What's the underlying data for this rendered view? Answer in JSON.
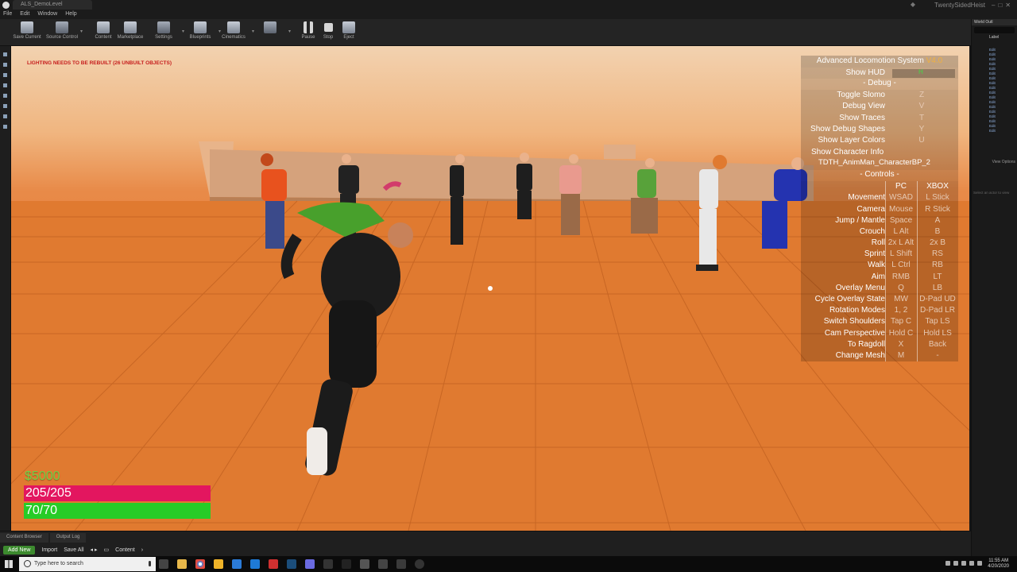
{
  "window": {
    "tab_title": "ALS_DemoLevel",
    "project": "TwentySidedHeist",
    "menu": [
      "File",
      "Edit",
      "Window",
      "Help"
    ]
  },
  "toolbar": [
    {
      "label": "Save Current",
      "icon": "save-icon"
    },
    {
      "label": "Source Control",
      "icon": "source-control-icon"
    },
    {
      "label": "Content",
      "icon": "content-icon"
    },
    {
      "label": "Marketplace",
      "icon": "marketplace-icon"
    },
    {
      "label": "Settings",
      "icon": "settings-icon"
    },
    {
      "label": "Blueprints",
      "icon": "blueprints-icon"
    },
    {
      "label": "Cinematics",
      "icon": "cinematics-icon"
    },
    {
      "label": "",
      "icon": "build-icon"
    },
    {
      "label": "Pause",
      "icon": "pause-icon"
    },
    {
      "label": "Stop",
      "icon": "stop-icon"
    },
    {
      "label": "Eject",
      "icon": "eject-icon"
    }
  ],
  "viewport": {
    "warning": "LIGHTING NEEDS TO BE REBUILT (26 unbuilt objects)"
  },
  "als": {
    "title": "Advanced Locomotion System",
    "version": "V4.0",
    "show_hud": {
      "label": "Show HUD",
      "value": "H"
    },
    "debug_header": "- Debug -",
    "debug_items": [
      {
        "label": "Toggle Slomo",
        "key": "Z"
      },
      {
        "label": "Debug View",
        "key": "V"
      },
      {
        "label": "Show Traces",
        "key": "T"
      },
      {
        "label": "Show Debug Shapes",
        "key": "Y"
      },
      {
        "label": "Show Layer Colors",
        "key": "U"
      }
    ],
    "char_info_label": "Show Character Info",
    "char_info_value": "TDTH_AnimMan_CharacterBP_2",
    "controls_header": "- Controls -",
    "col_pc": "PC",
    "col_xbox": "XBOX",
    "controls": [
      {
        "label": "Movement",
        "pc": "WSAD",
        "xbox": "L Stick"
      },
      {
        "label": "Camera",
        "pc": "Mouse",
        "xbox": "R Stick"
      },
      {
        "label": "Jump / Mantle",
        "pc": "Space",
        "xbox": "A"
      },
      {
        "label": "Crouch",
        "pc": "L Alt",
        "xbox": "B"
      },
      {
        "label": "Roll",
        "pc": "2x L Alt",
        "xbox": "2x B"
      },
      {
        "label": "Sprint",
        "pc": "L Shift",
        "xbox": "RS"
      },
      {
        "label": "Walk",
        "pc": "L Ctrl",
        "xbox": "RB"
      },
      {
        "label": "Aim",
        "pc": "RMB",
        "xbox": "LT"
      },
      {
        "label": "Overlay Menu",
        "pc": "Q",
        "xbox": "LB"
      },
      {
        "label": "Cycle Overlay State",
        "pc": "MW",
        "xbox": "D-Pad UD"
      },
      {
        "label": "Rotation Modes",
        "pc": "1, 2",
        "xbox": "D-Pad LR"
      },
      {
        "label": "Switch Shoulders",
        "pc": "Tap C",
        "xbox": "Tap LS"
      },
      {
        "label": "Cam Perspective",
        "pc": "Hold C",
        "xbox": "Hold LS"
      },
      {
        "label": "To Ragdoll",
        "pc": "X",
        "xbox": "Back"
      },
      {
        "label": "Change Mesh",
        "pc": "M",
        "xbox": "-"
      }
    ]
  },
  "hud": {
    "money": "$5000",
    "health": {
      "text": "205/205",
      "fraction": 1.0,
      "color": "#e3165f"
    },
    "stamina": {
      "text": "70/70",
      "fraction": 1.0,
      "color": "#27cc27"
    }
  },
  "bottom": {
    "tabs": [
      "Content Browser",
      "Output Log"
    ],
    "add_new": "Add New",
    "import": "Import",
    "save_all": "Save All",
    "path": "Content"
  },
  "outliner": {
    "title": "World Outl",
    "column": "Label",
    "row_label": "Edit",
    "rows": 18,
    "view_options": "View Options",
    "hint": "Select an actor to view"
  },
  "taskbar": {
    "search_placeholder": "Type here to search",
    "time": "11:55 AM",
    "date": "4/20/2020"
  }
}
